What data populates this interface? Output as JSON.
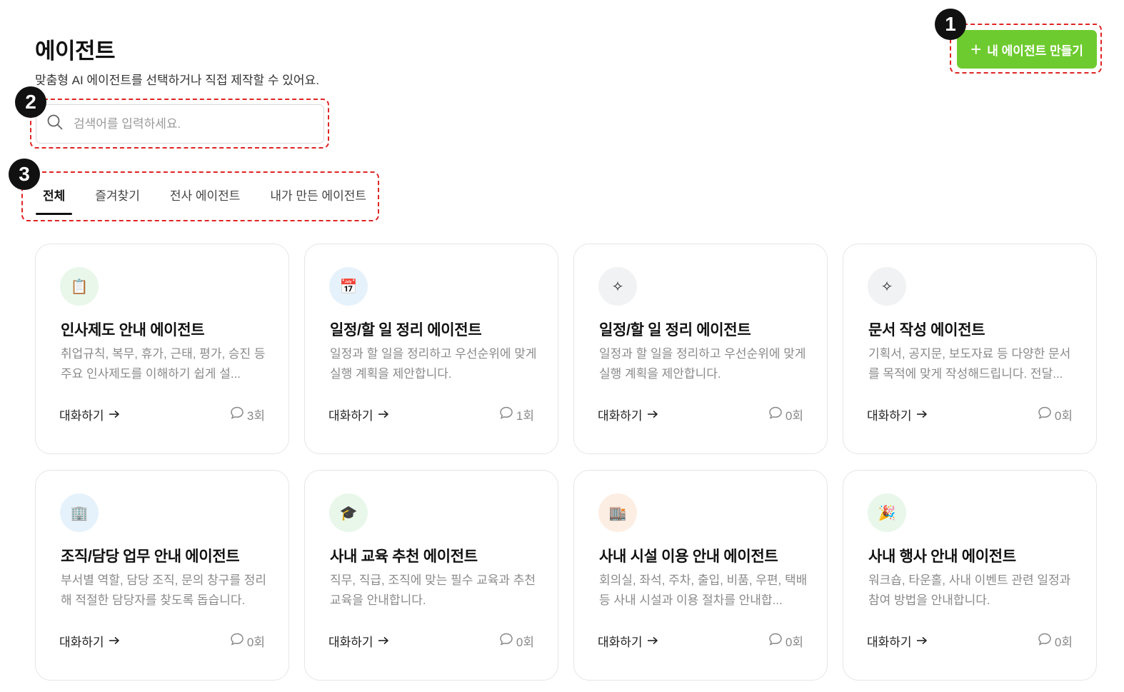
{
  "header": {
    "title": "에이전트",
    "subtitle": "맞춤형 AI 에이전트를 선택하거나 직접 제작할 수 있어요.",
    "create_button_label": "내 에이전트 만들기"
  },
  "search": {
    "placeholder": "검색어를 입력하세요."
  },
  "tabs": [
    {
      "label": "전체",
      "active": true
    },
    {
      "label": "즐겨찾기",
      "active": false
    },
    {
      "label": "전사 에이전트",
      "active": false
    },
    {
      "label": "내가 만든 에이전트",
      "active": false
    }
  ],
  "annotations": [
    "1",
    "2",
    "3"
  ],
  "cards": [
    {
      "icon": "clipboard-icon",
      "icon_glyph": "📋",
      "icon_bg": "#e8f7ea",
      "title": "인사제도 안내 에이전트",
      "description": "취업규칙, 복무, 휴가, 근태, 평가, 승진 등 주요 인사제도를 이해하기 쉽게 설...",
      "chat_label": "대화하기",
      "count": "3회"
    },
    {
      "icon": "calendar-icon",
      "icon_glyph": "📅",
      "icon_bg": "#e6f2fb",
      "title": "일정/할 일 정리 에이전트",
      "description": "일정과 할 일을 정리하고 우선순위에 맞게 실행 계획을 제안합니다.",
      "chat_label": "대화하기",
      "count": "1회"
    },
    {
      "icon": "sparkle-icon",
      "icon_glyph": "✧",
      "icon_bg": "#f1f2f4",
      "title": "일정/할 일 정리 에이전트",
      "description": "일정과 할 일을 정리하고 우선순위에 맞게 실행 계획을 제안합니다.",
      "chat_label": "대화하기",
      "count": "0회"
    },
    {
      "icon": "sparkle-icon",
      "icon_glyph": "✧",
      "icon_bg": "#f1f2f4",
      "title": "문서 작성 에이전트",
      "description": "기획서, 공지문, 보도자료 등 다양한 문서를 목적에 맞게 작성해드립니다. 전달...",
      "chat_label": "대화하기",
      "count": "0회"
    },
    {
      "icon": "office-building-icon",
      "icon_glyph": "🏢",
      "icon_bg": "#e6f2fb",
      "title": "조직/담당 업무 안내 에이전트",
      "description": "부서별 역할, 담당 조직, 문의 창구를 정리해 적절한 담당자를 찾도록 돕습니다.",
      "chat_label": "대화하기",
      "count": "0회"
    },
    {
      "icon": "graduation-cap-icon",
      "icon_glyph": "🎓",
      "icon_bg": "#e8f7ea",
      "title": "사내 교육 추천 에이전트",
      "description": "직무, 직급, 조직에 맞는 필수 교육과 추천 교육을 안내합니다.",
      "chat_label": "대화하기",
      "count": "0회"
    },
    {
      "icon": "building-icon",
      "icon_glyph": "🏬",
      "icon_bg": "#fdeee4",
      "title": "사내 시설 이용 안내 에이전트",
      "description": "회의실, 좌석, 주차, 출입, 비품, 우편, 택배 등 사내 시설과 이용 절차를 안내합...",
      "chat_label": "대화하기",
      "count": "0회"
    },
    {
      "icon": "party-popper-icon",
      "icon_glyph": "🎉",
      "icon_bg": "#e8f7ea",
      "title": "사내 행사 안내 에이전트",
      "description": "워크숍, 타운홀, 사내 이벤트 관련 일정과 참여 방법을 안내합니다.",
      "chat_label": "대화하기",
      "count": "0회"
    }
  ]
}
